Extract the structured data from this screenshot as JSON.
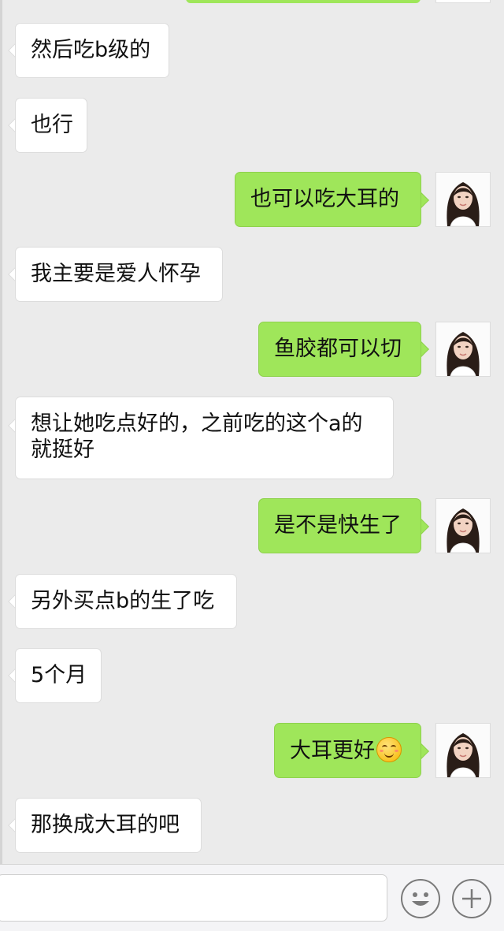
{
  "messages": [
    {
      "side": "in",
      "text": "然后吃b级的"
    },
    {
      "side": "in",
      "text": "也行"
    },
    {
      "side": "out",
      "text": "也可以吃大耳的"
    },
    {
      "side": "in",
      "text": "我主要是爱人怀孕"
    },
    {
      "side": "out",
      "text": "鱼胶都可以切"
    },
    {
      "side": "in",
      "text": "想让她吃点好的，之前吃的这个a的就挺好"
    },
    {
      "side": "out",
      "text": "是不是快生了"
    },
    {
      "side": "in",
      "text": "另外买点b的生了吃"
    },
    {
      "side": "in",
      "text": "5个月"
    },
    {
      "side": "out",
      "text": "大耳更好",
      "emoji": "smiling-face-emoji"
    },
    {
      "side": "in",
      "text": "那换成大耳的吧"
    }
  ],
  "input": {
    "value": "",
    "placeholder": ""
  },
  "icons": {
    "emoji_button": "smiley-icon",
    "more_button": "plus-icon",
    "avatar": "user-avatar-icon"
  },
  "colors": {
    "background": "#ebebeb",
    "outgoing_bubble": "#9fe65a",
    "incoming_bubble": "#ffffff"
  }
}
